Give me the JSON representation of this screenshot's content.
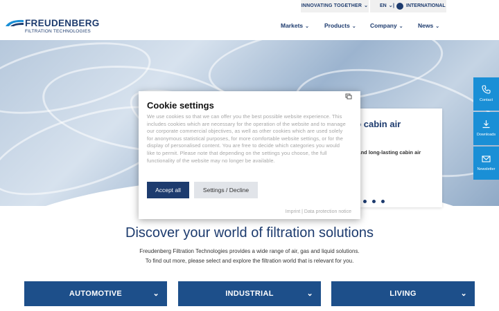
{
  "topbar": {
    "innovating": "INNOVATING TOGETHER",
    "lang": "EN",
    "separator": "|",
    "international": "INTERNATIONAL"
  },
  "logo": {
    "name": "FREUDENBERG",
    "sub": "FILTRATION TECHNOLOGIES"
  },
  "nav": {
    "items": [
      {
        "label": "Markets"
      },
      {
        "label": "Products"
      },
      {
        "label": "Company"
      },
      {
        "label": "News"
      }
    ]
  },
  "slide": {
    "title": "eo cabin air",
    "text": "ce and long-lasting cabin air"
  },
  "side": {
    "contact": "Contact",
    "downloads": "Downloads",
    "newsletter": "Newsletter"
  },
  "discover": {
    "title": "Discover your world of filtration solutions",
    "line1": "Freudenberg Filtration Technologies provides a wide range of air, gas and liquid solutions.",
    "line2": "To find out more, please select and explore the filtration world that is relevant for you."
  },
  "categories": [
    {
      "label": "AUTOMOTIVE"
    },
    {
      "label": "INDUSTRIAL"
    },
    {
      "label": "LIVING"
    }
  ],
  "cookie": {
    "title": "Cookie settings",
    "body": "We use cookies so that we can offer you the best possible website experience. This includes cookies which are necessary for the operation of the website and to manage our corporate commercial objectives, as well as other cookies which are used solely for anonymous statistical purposes, for more comfortable website settings, or for the display of personalised content. You are free to decide which categories you would like to permit. Please note that depending on the settings you choose, the full functionality of the website may no longer be available.",
    "accept": "Accept all",
    "decline": "Settings / Decline",
    "links": "Imprint | Data protection notice"
  },
  "colors": {
    "brand": "#1d3b6e",
    "side_tab": "#1a8fd6",
    "category": "#1d4f8a"
  }
}
